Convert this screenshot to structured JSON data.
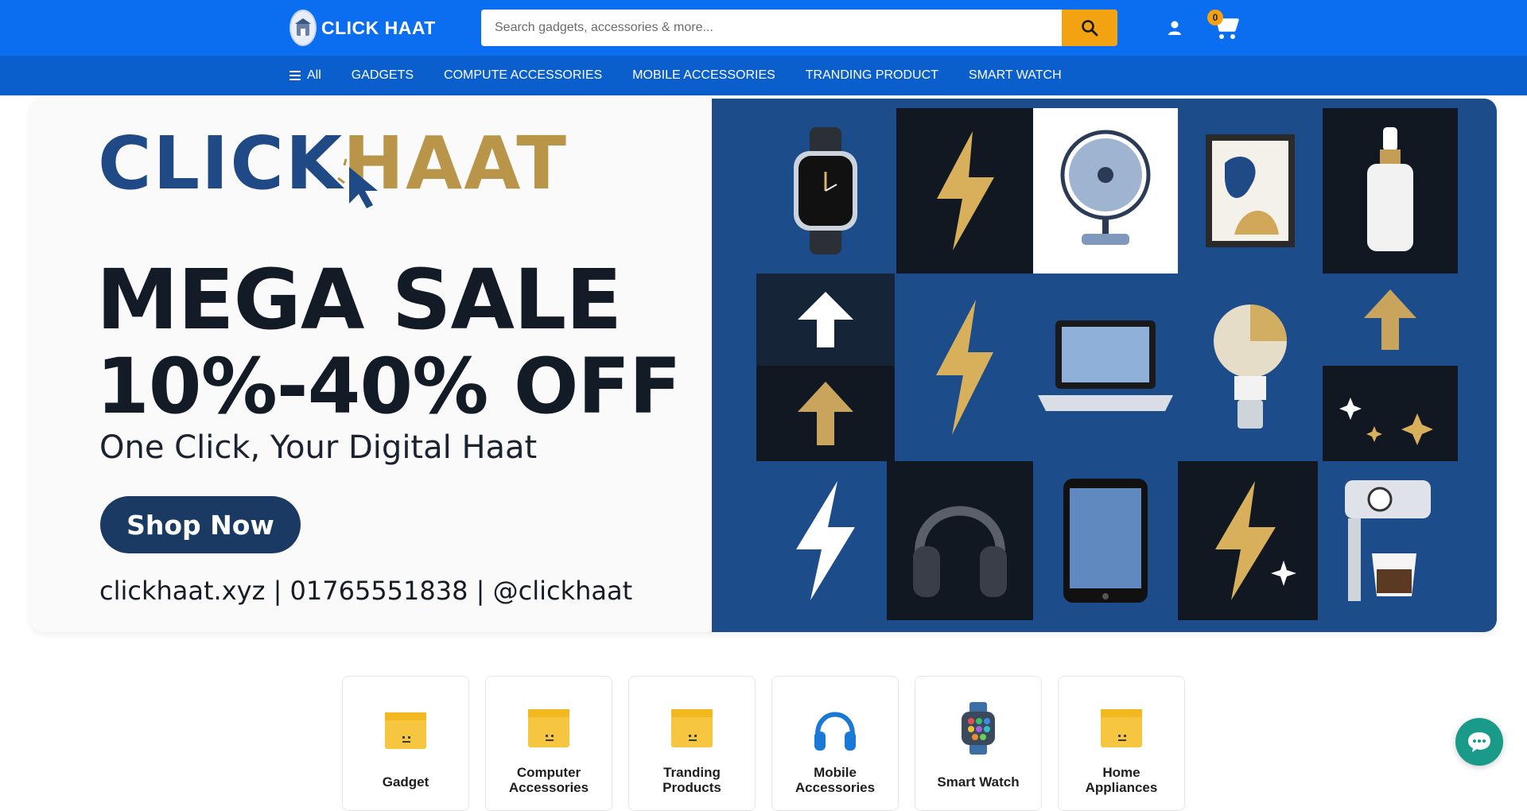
{
  "header": {
    "logo_text": "CLICK HAAT",
    "search_placeholder": "Search gadgets, accessories & more...",
    "cart_count": "0"
  },
  "nav": {
    "all_label": "All",
    "items": [
      "GADGETS",
      "COMPUTE ACCESSORIES",
      "MOBILE ACCESSORIES",
      "TRANDING PRODUCT",
      "SMART WATCH"
    ]
  },
  "hero": {
    "brand_left": "CLICK",
    "brand_right": "HAAT",
    "headline": "MEGA SALE",
    "discount": "10%-40% OFF",
    "tagline": "One Click, Your Digital Haat",
    "cta": "Shop Now",
    "contact": "clickhaat.xyz  |  01765551838  |  @clickhaat"
  },
  "categories": [
    {
      "label": "Gadget",
      "icon": "box-icon"
    },
    {
      "label": "Computer Accessories",
      "icon": "box-icon"
    },
    {
      "label": "Tranding Products",
      "icon": "box-icon"
    },
    {
      "label": "Mobile Accessories",
      "icon": "headphones-icon"
    },
    {
      "label": "Smart Watch",
      "icon": "smartwatch-icon"
    },
    {
      "label": "Home Appliances",
      "icon": "box-icon"
    }
  ],
  "colors": {
    "header_bg": "#0b6df0",
    "nav_bg": "#0a5fcc",
    "accent": "#f3a312",
    "hero_panel": "#1d4c8a",
    "chat": "#1a9b8a"
  }
}
